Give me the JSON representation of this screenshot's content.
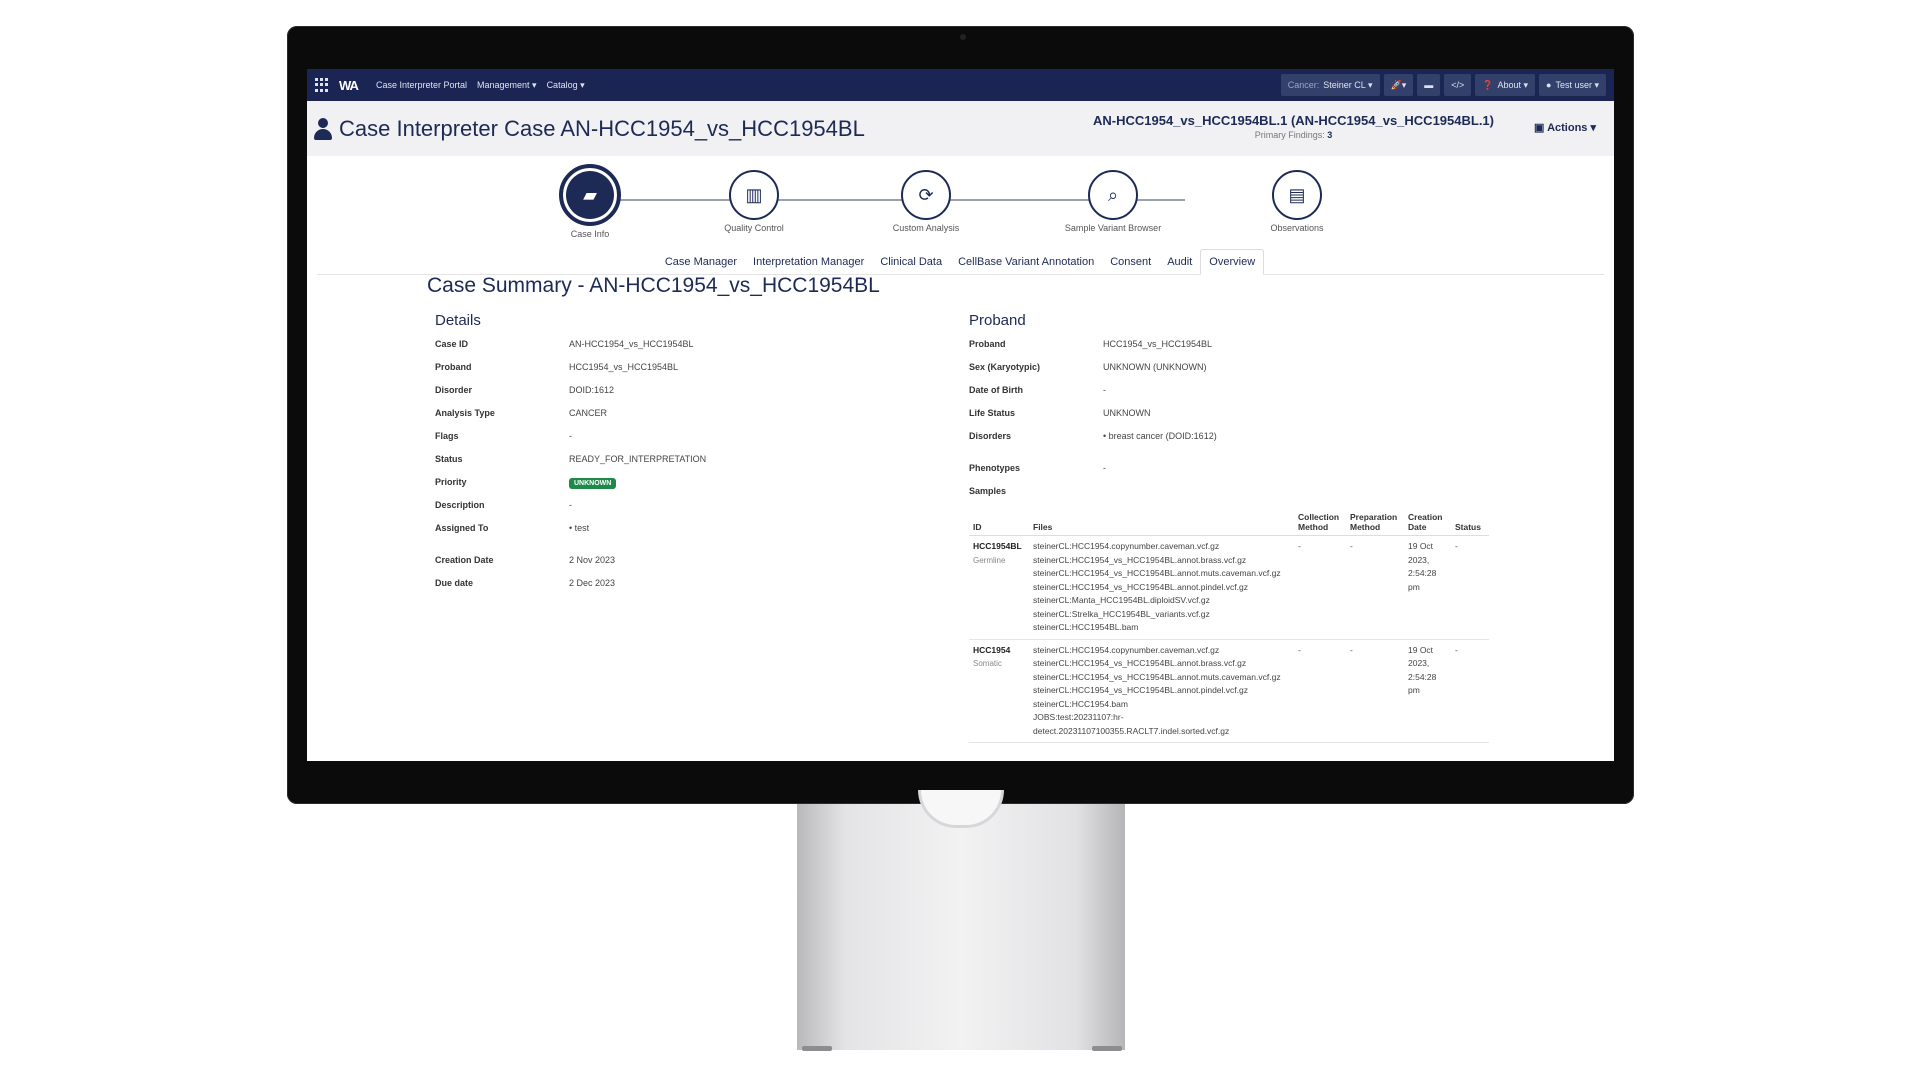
{
  "navbar": {
    "logo": "WA",
    "links": [
      "Case Interpreter Portal",
      "Management ▾",
      "Catalog ▾"
    ],
    "cancer_label": "Cancer:",
    "cancer_value": "Steiner CL ▾",
    "about": "About ▾",
    "user": "Test user ▾"
  },
  "header": {
    "title": "Case Interpreter Case AN-HCC1954_vs_HCC1954BL",
    "subtitle": "AN-HCC1954_vs_HCC1954BL.1 (AN-HCC1954_vs_HCC1954BL.1)",
    "findings_label": "Primary Findings:",
    "findings_value": "3",
    "actions": "Actions ▾"
  },
  "steps": [
    {
      "label": "Case Info",
      "icon": "folder-open-icon"
    },
    {
      "label": "Quality Control",
      "icon": "chart-icon"
    },
    {
      "label": "Custom Analysis",
      "icon": "refresh-icon"
    },
    {
      "label": "Sample Variant Browser",
      "icon": "search-icon"
    },
    {
      "label": "Observations",
      "icon": "document-icon"
    }
  ],
  "tabs": [
    "Case Manager",
    "Interpretation Manager",
    "Clinical Data",
    "CellBase Variant Annotation",
    "Consent",
    "Audit",
    "Overview"
  ],
  "summary": {
    "title": "Case Summary - AN-HCC1954_vs_HCC1954BL",
    "details_title": "Details",
    "details": [
      {
        "k": "Case ID",
        "v": "AN-HCC1954_vs_HCC1954BL"
      },
      {
        "k": "Proband",
        "v": "HCC1954_vs_HCC1954BL"
      },
      {
        "k": "Disorder",
        "v": "DOID:1612"
      },
      {
        "k": "Analysis Type",
        "v": "CANCER"
      },
      {
        "k": "Flags",
        "v": "-"
      },
      {
        "k": "Status",
        "v": "READY_FOR_INTERPRETATION"
      },
      {
        "k": "Priority",
        "v": "UNKNOWN"
      },
      {
        "k": "Description",
        "v": "-"
      },
      {
        "k": "Assigned To",
        "v": "test"
      },
      {
        "k": "Creation Date",
        "v": "2 Nov 2023"
      },
      {
        "k": "Due date",
        "v": "2 Dec 2023"
      }
    ],
    "proband_title": "Proband",
    "proband": [
      {
        "k": "Proband",
        "v": "HCC1954_vs_HCC1954BL"
      },
      {
        "k": "Sex (Karyotypic)",
        "v": "UNKNOWN (UNKNOWN)"
      },
      {
        "k": "Date of Birth",
        "v": "-"
      },
      {
        "k": "Life Status",
        "v": "UNKNOWN"
      },
      {
        "k": "Disorders",
        "v": "breast cancer (DOID:1612)"
      },
      {
        "k": "Phenotypes",
        "v": "-"
      },
      {
        "k": "Samples",
        "v": ""
      }
    ],
    "samples_headers": [
      "ID",
      "Files",
      "Collection Method",
      "Preparation Method",
      "Creation Date",
      "Status"
    ],
    "samples": [
      {
        "id": "HCC1954BL",
        "type": "Germline",
        "files": "steinerCL:HCC1954.copynumber.caveman.vcf.gz\nsteinerCL:HCC1954_vs_HCC1954BL.annot.brass.vcf.gz\nsteinerCL:HCC1954_vs_HCC1954BL.annot.muts.caveman.vcf.gz\nsteinerCL:HCC1954_vs_HCC1954BL.annot.pindel.vcf.gz\nsteinerCL:Manta_HCC1954BL.diploidSV.vcf.gz\nsteinerCL:Strelka_HCC1954BL_variants.vcf.gz\nsteinerCL:HCC1954BL.bam",
        "collection": "-",
        "preparation": "-",
        "created": "19 Oct 2023, 2:54:28 pm",
        "status": "-"
      },
      {
        "id": "HCC1954",
        "type": "Somatic",
        "files": "steinerCL:HCC1954.copynumber.caveman.vcf.gz\nsteinerCL:HCC1954_vs_HCC1954BL.annot.brass.vcf.gz\nsteinerCL:HCC1954_vs_HCC1954BL.annot.muts.caveman.vcf.gz\nsteinerCL:HCC1954_vs_HCC1954BL.annot.pindel.vcf.gz\nsteinerCL:HCC1954.bam\nJOBS:test:20231107:hr-\ndetect.20231107100355.RACLT7.indel.sorted.vcf.gz",
        "collection": "-",
        "preparation": "-",
        "created": "19 Oct 2023, 2:54:28 pm",
        "status": "-"
      }
    ]
  },
  "colors": {
    "navy": "#1b2554",
    "accent": "#1d2a55",
    "badge": "#1e8a4a"
  }
}
